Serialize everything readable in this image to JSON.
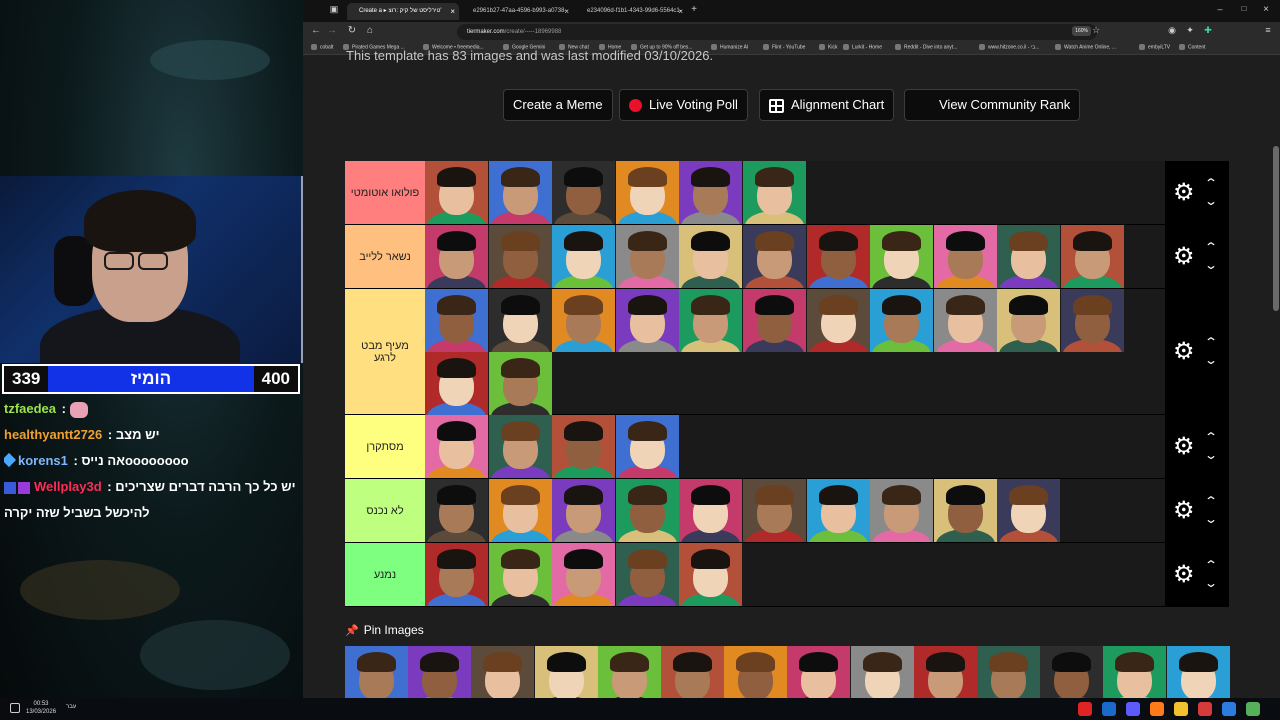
{
  "stream": {
    "poll": {
      "left_score": "339",
      "title": "הומיז",
      "right_score": "400"
    },
    "chat": [
      {
        "user": "tzfaedea",
        "color": "#9be44a",
        "sep": " : ",
        "text": "",
        "emote": "#e9a1b5"
      },
      {
        "user": "healthyantt2726",
        "color": "#f0a030",
        "sep": " : ",
        "text": "יש מצב"
      },
      {
        "user": "korens1",
        "color": "#7fb6ff",
        "sep": " : ",
        "text": "אה נייסoooooooo"
      },
      {
        "user": "Wellplay3d",
        "color": "#ff2d55",
        "sep": " : ",
        "text": "יש כל כך הרבה דברים שצריכים"
      }
    ],
    "chat_continuation": "להיכשל בשביל שזה יקרה"
  },
  "taskbar": {
    "time": "00:53",
    "date": "13/03/2026",
    "lang": "עבר"
  },
  "browser": {
    "tabs": [
      {
        "label": "Create a ▸ טירליסט של קיק :רוצ'",
        "active": true
      },
      {
        "label": "e2961b27-47aa-4596-b993-a0738-",
        "active": false
      },
      {
        "label": "e234096d-f1b1-4343-99d6-5564c1-",
        "active": false
      }
    ],
    "new_tab": "+",
    "url_host": "tiermaker.com",
    "url_path": "/create/-----18969988",
    "zoom": "160%",
    "bookmarks": [
      "cobalt",
      "Pirated Games Mega ...",
      "Welcome • freemedia...",
      "Google Gemini",
      "New chat",
      "Home",
      "Get up to 90% off bes...",
      "Humanize AI",
      "Flint - YouTube",
      "Kick",
      "Lurkit - Home",
      "Reddit - Dive into anyt...",
      "www.hitzone.co.il - בי...",
      "Watch Anime Online, ...",
      "embyiLTV",
      "Content"
    ]
  },
  "page": {
    "template_note": "This template has 83 images and was last modified 03/10/2026.",
    "buttons": {
      "create_meme": "Create a Meme",
      "live_poll": "Live Voting Poll",
      "alignment": "Alignment Chart",
      "community": "View Community Rank"
    },
    "tiers": [
      {
        "label": "פולואו אוטומטי",
        "color": "#ff7f7f",
        "items": 6
      },
      {
        "label": "נשאר ללייב",
        "color": "#ffbf7f",
        "items": 11
      },
      {
        "label": "מעיף מבט לרגע",
        "color": "#ffdf7f",
        "items": 13
      },
      {
        "label": "מסתקרן",
        "color": "#ffff7f",
        "items": 4
      },
      {
        "label": "לא נכנס",
        "color": "#bfff7f",
        "items": 10
      },
      {
        "label": "נמנע",
        "color": "#7fff7f",
        "items": 5
      }
    ],
    "pin_title": "Pin Images",
    "gear_icon": "⚙",
    "up_icon": "⌃",
    "down_icon": "⌄"
  }
}
